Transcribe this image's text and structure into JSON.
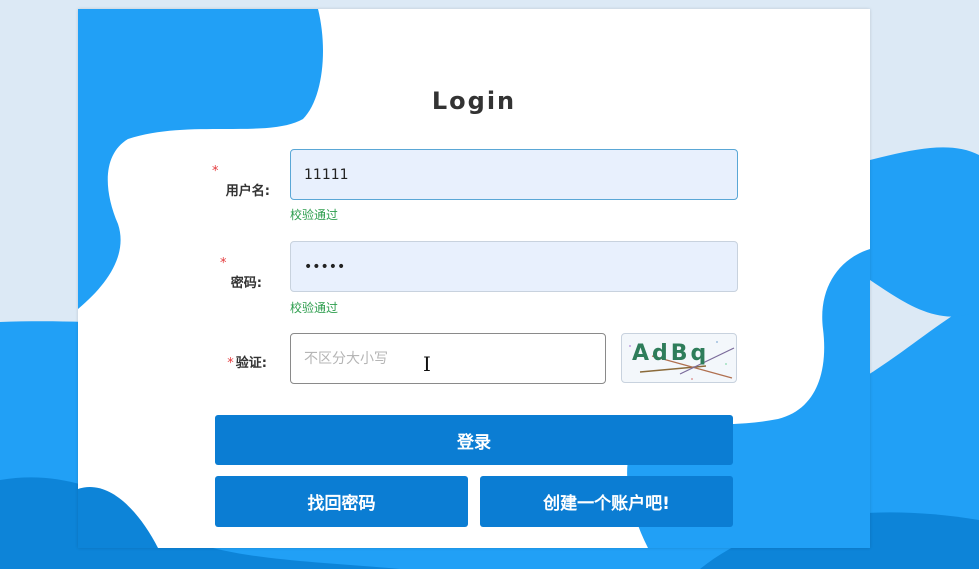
{
  "form": {
    "title": "Login",
    "username": {
      "label": "用户名:",
      "value": "11111",
      "status": "校验通过"
    },
    "password": {
      "label": "密码:",
      "value": "11111",
      "status": "校验通过"
    },
    "captcha": {
      "label": "验证:",
      "placeholder": "不区分大小写",
      "image_text": "AdBq"
    },
    "required_marker": "*"
  },
  "buttons": {
    "login": "登录",
    "recover": "找回密码",
    "register": "创建一个账户吧!"
  },
  "colors": {
    "accent": "#0b7dd3",
    "background_wave": "#21a0f6",
    "success": "#2e9e4e",
    "required": "#e4393c"
  }
}
